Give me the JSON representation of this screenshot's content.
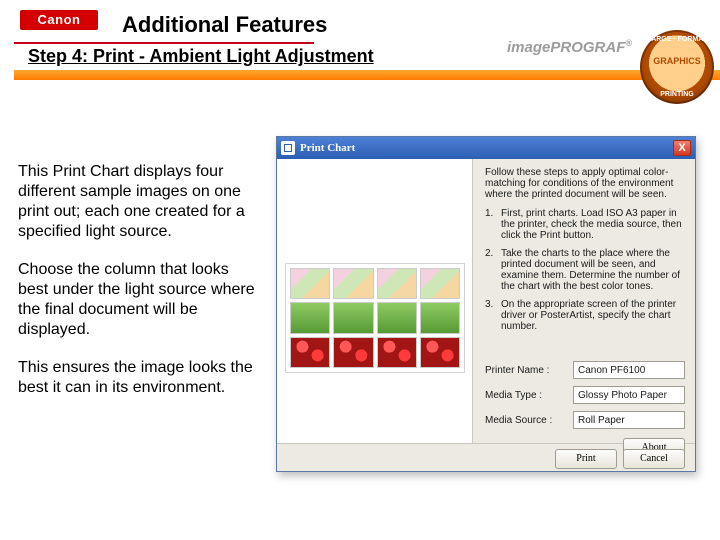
{
  "header": {
    "logo_text": "Canon",
    "title": "Additional Features",
    "step": "Step 4: Print - Ambient Light Adjustment",
    "brand": "imagePROGRAF",
    "seal_top": "LARGE · FORMAT",
    "seal_center_top": "GRAPHICS",
    "seal_bottom": "PRINTING"
  },
  "description": {
    "p1": "This Print Chart displays four different sample images on one print out; each one created for a specified light source.",
    "p2": "Choose the column that looks best under the light source where the final document will be displayed.",
    "p3": "This ensures the image looks the best it can in its environment."
  },
  "dialog": {
    "title": "Print Chart",
    "close": "X",
    "lead": "Follow these steps to apply optimal color-matching for conditions of the environment where the printed document will be seen.",
    "steps": [
      {
        "n": "1.",
        "t": "First, print charts. Load ISO A3 paper in the printer, check the media source, then click the Print button."
      },
      {
        "n": "2.",
        "t": "Take the charts to the place where the printed document will be seen, and examine them. Determine the number of the chart with the best color tones."
      },
      {
        "n": "3.",
        "t": "On the appropriate screen of the printer driver or PosterArtist, specify the chart number."
      }
    ],
    "fields": {
      "printer_label": "Printer Name :",
      "printer_value": "Canon PF6100",
      "media_type_label": "Media Type :",
      "media_type_value": "Glossy Photo Paper",
      "media_source_label": "Media Source :",
      "media_source_value": "Roll Paper"
    },
    "buttons": {
      "about": "About",
      "print": "Print",
      "cancel": "Cancel"
    }
  }
}
